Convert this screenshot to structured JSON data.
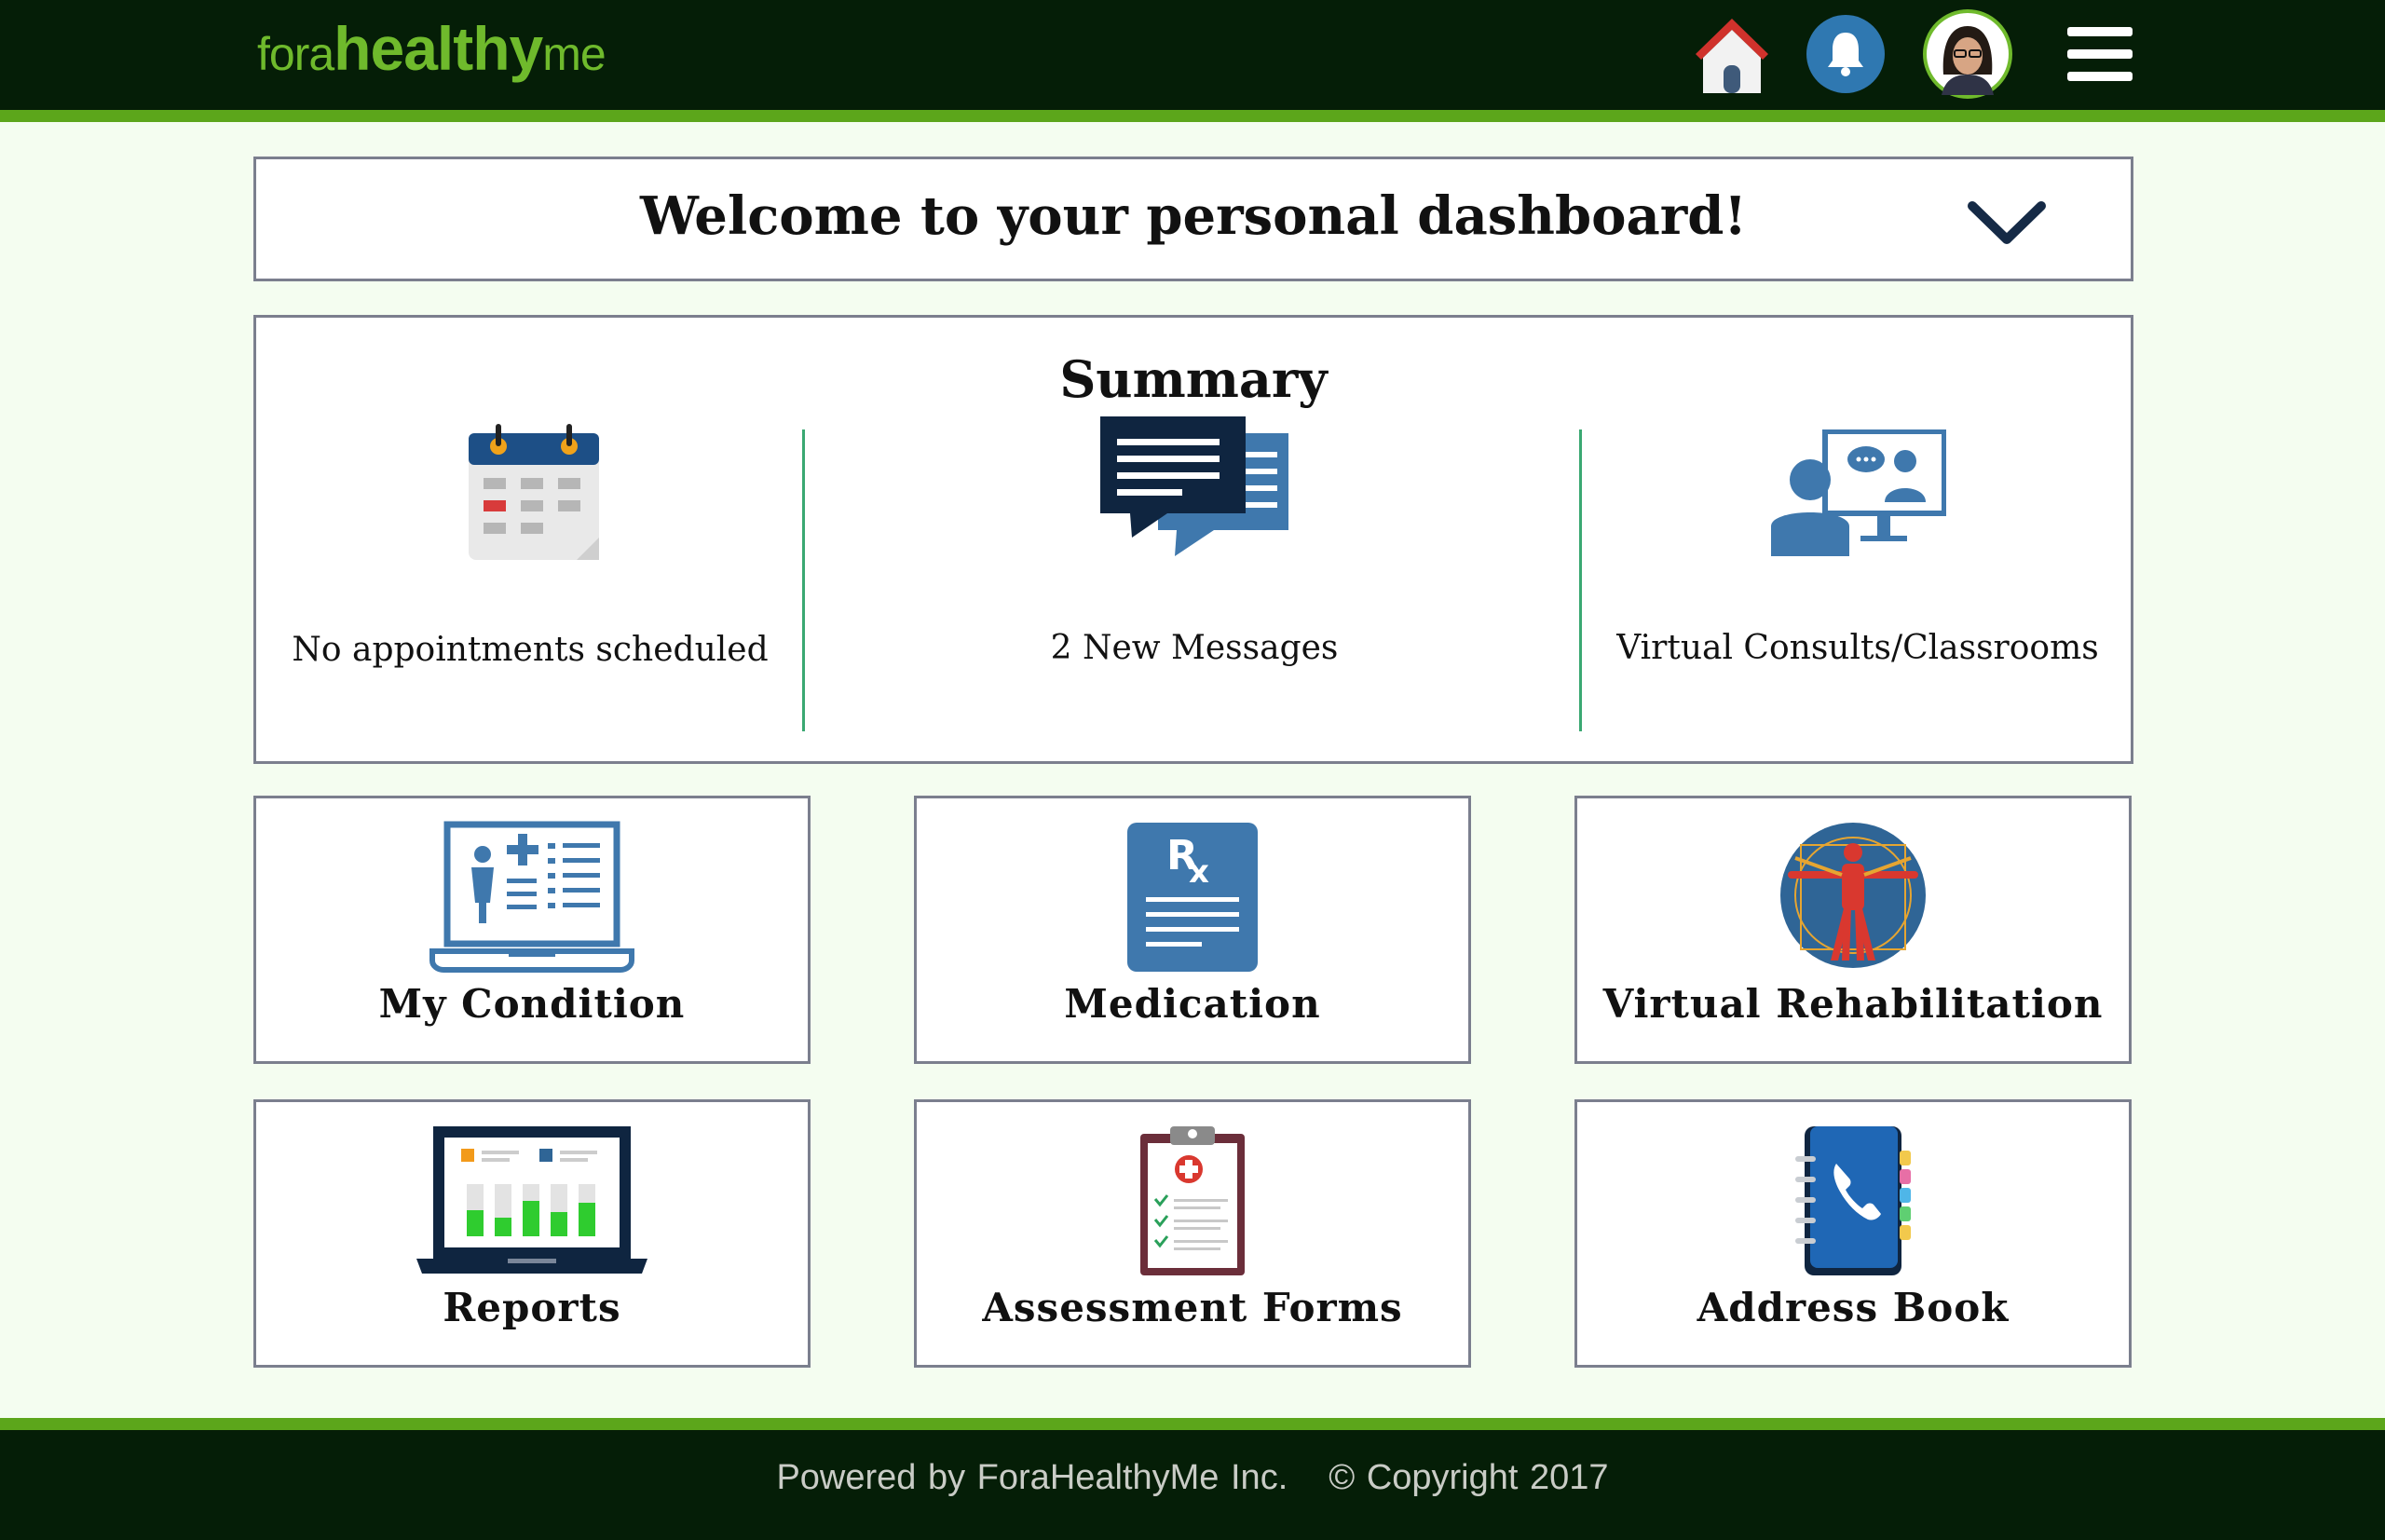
{
  "brand": {
    "fora": "fora",
    "healthy": "healthy",
    "me": "me",
    "color": "#6fba2c"
  },
  "header": {
    "icons": [
      "home-icon",
      "bell-icon",
      "user-avatar",
      "hamburger-menu-icon"
    ],
    "bg_color": "#051e07",
    "stripe_color": "#5ca61b"
  },
  "welcome": {
    "title": "Welcome to your personal dashboard!",
    "toggle_icon": "chevron-down-icon"
  },
  "summary": {
    "title": "Summary",
    "items": [
      {
        "label": "No appointments scheduled",
        "icon": "calendar-icon"
      },
      {
        "label": "2 New Messages",
        "icon": "messages-icon"
      },
      {
        "label": "Virtual Consults/Classrooms",
        "icon": "video-consult-icon"
      }
    ]
  },
  "tiles": [
    {
      "label": "My Condition",
      "icon": "medical-chart-laptop-icon"
    },
    {
      "label": "Medication",
      "icon": "prescription-icon"
    },
    {
      "label": "Virtual Rehabilitation",
      "icon": "vitruvian-man-icon"
    },
    {
      "label": "Reports",
      "icon": "reports-laptop-icon"
    },
    {
      "label": "Assessment Forms",
      "icon": "clipboard-icon"
    },
    {
      "label": "Address Book",
      "icon": "address-book-icon"
    }
  ],
  "footer": {
    "powered": "Powered by ForaHealthyMe Inc.",
    "copyright": "© Copyright 2017"
  }
}
